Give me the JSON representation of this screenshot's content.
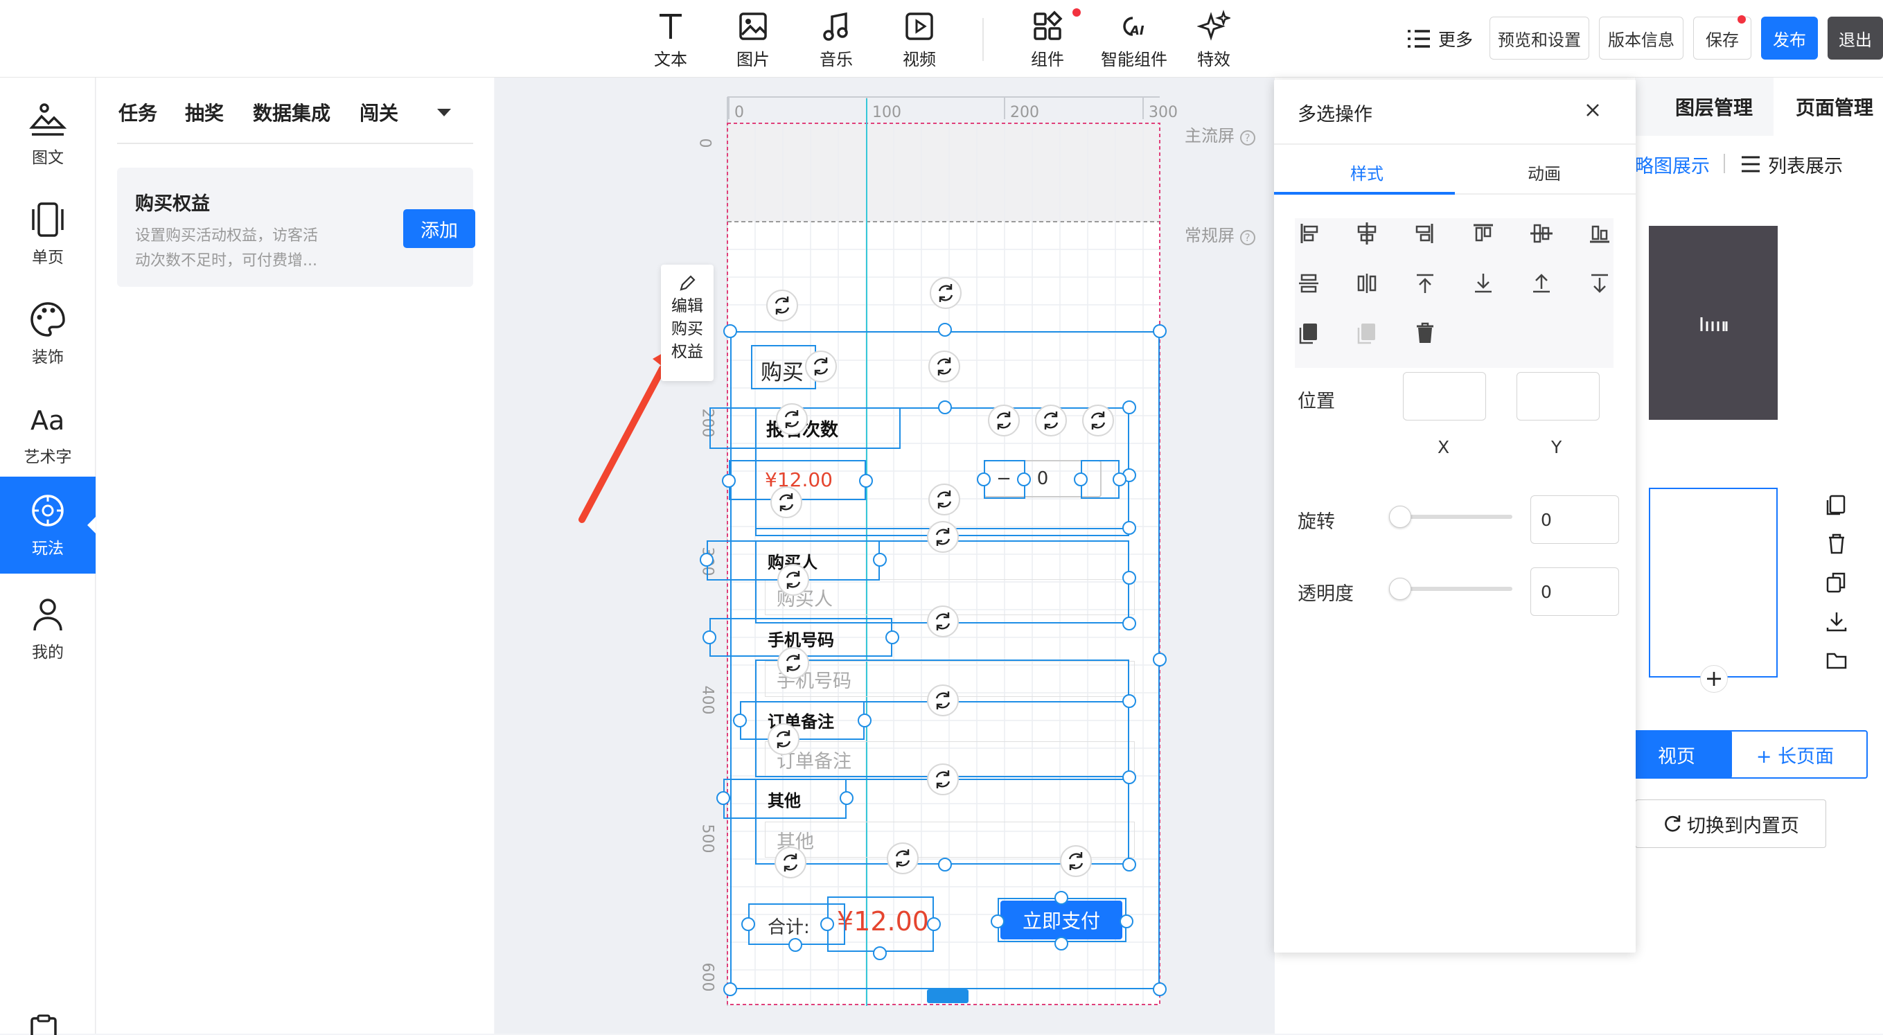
{
  "toolbar": {
    "items": [
      {
        "label": "文本",
        "icon": "text-icon"
      },
      {
        "label": "图片",
        "icon": "image-icon"
      },
      {
        "label": "音乐",
        "icon": "music-icon"
      },
      {
        "label": "视频",
        "icon": "video-icon"
      },
      {
        "label": "组件",
        "icon": "component-icon"
      },
      {
        "label": "智能组件",
        "icon": "ai-component-icon"
      },
      {
        "label": "特效",
        "icon": "sparkle-icon"
      }
    ],
    "more": "更多",
    "preview": "预览和设置",
    "version": "版本信息",
    "save": "保存",
    "publish": "发布",
    "exit": "退出"
  },
  "leftnav": {
    "items": [
      {
        "label": "图文",
        "icon": "image-text-icon"
      },
      {
        "label": "单页",
        "icon": "single-page-icon"
      },
      {
        "label": "装饰",
        "icon": "palette-icon"
      },
      {
        "label": "艺术字",
        "icon": "art-text-icon"
      },
      {
        "label": "玩法",
        "icon": "gameplay-icon"
      },
      {
        "label": "我的",
        "icon": "user-icon"
      }
    ],
    "active": "玩法"
  },
  "panel": {
    "tabs": [
      "任务",
      "抽奖",
      "数据集成",
      "闯关"
    ],
    "card": {
      "title": "购买权益",
      "desc_line1": "设置购买活动权益，访客活",
      "desc_line2": "动次数不足时，可付费增...",
      "add_label": "添加"
    }
  },
  "canvas": {
    "ruler_top": [
      "0",
      "100",
      "200",
      "300"
    ],
    "ruler_left": [
      "0",
      "200",
      "300",
      "400",
      "500",
      "600"
    ],
    "main_screen": "主流屏",
    "normal_screen": "常规屏",
    "edit_tooltip": [
      "编辑",
      "购买",
      "权益"
    ],
    "form": {
      "title_partial": "购买",
      "count_label": "报名次数",
      "price": "¥12.00",
      "stepper_minus": "−",
      "stepper_value": "0",
      "stepper_plus": "+",
      "buyer_label": "购买人",
      "buyer_placeholder": "购买人",
      "phone_label": "手机号码",
      "phone_placeholder": "手机号码",
      "note_label": "订单备注",
      "note_placeholder": "订单备注",
      "other_label": "其他",
      "other_placeholder": "其他",
      "total_label": "合计:",
      "total_value": "¥12.00",
      "pay_button": "立即支付"
    }
  },
  "multi_select": {
    "title": "多选操作",
    "tabs": [
      "样式",
      "动画"
    ],
    "position_label": "位置",
    "x_label": "X",
    "y_label": "Y",
    "x_value": "",
    "y_value": "",
    "rotate_label": "旋转",
    "rotate_value": "0",
    "opacity_label": "透明度",
    "opacity_value": "0",
    "rotate_slider_fraction": 0,
    "opacity_slider_fraction": 0
  },
  "right": {
    "tabs": [
      "图层管理",
      "页面管理"
    ],
    "views": [
      "略图展示",
      "列表展示"
    ],
    "buttons": {
      "normal_page": "视页",
      "long_page": "+ 长页面",
      "switch": "切换到内置页"
    }
  },
  "colors": {
    "accent": "#1677ff",
    "selection": "#1e8ee6",
    "price_red": "#e5452f",
    "guide_pink": "#e0407a",
    "guide_cyan": "#35c7d8"
  }
}
